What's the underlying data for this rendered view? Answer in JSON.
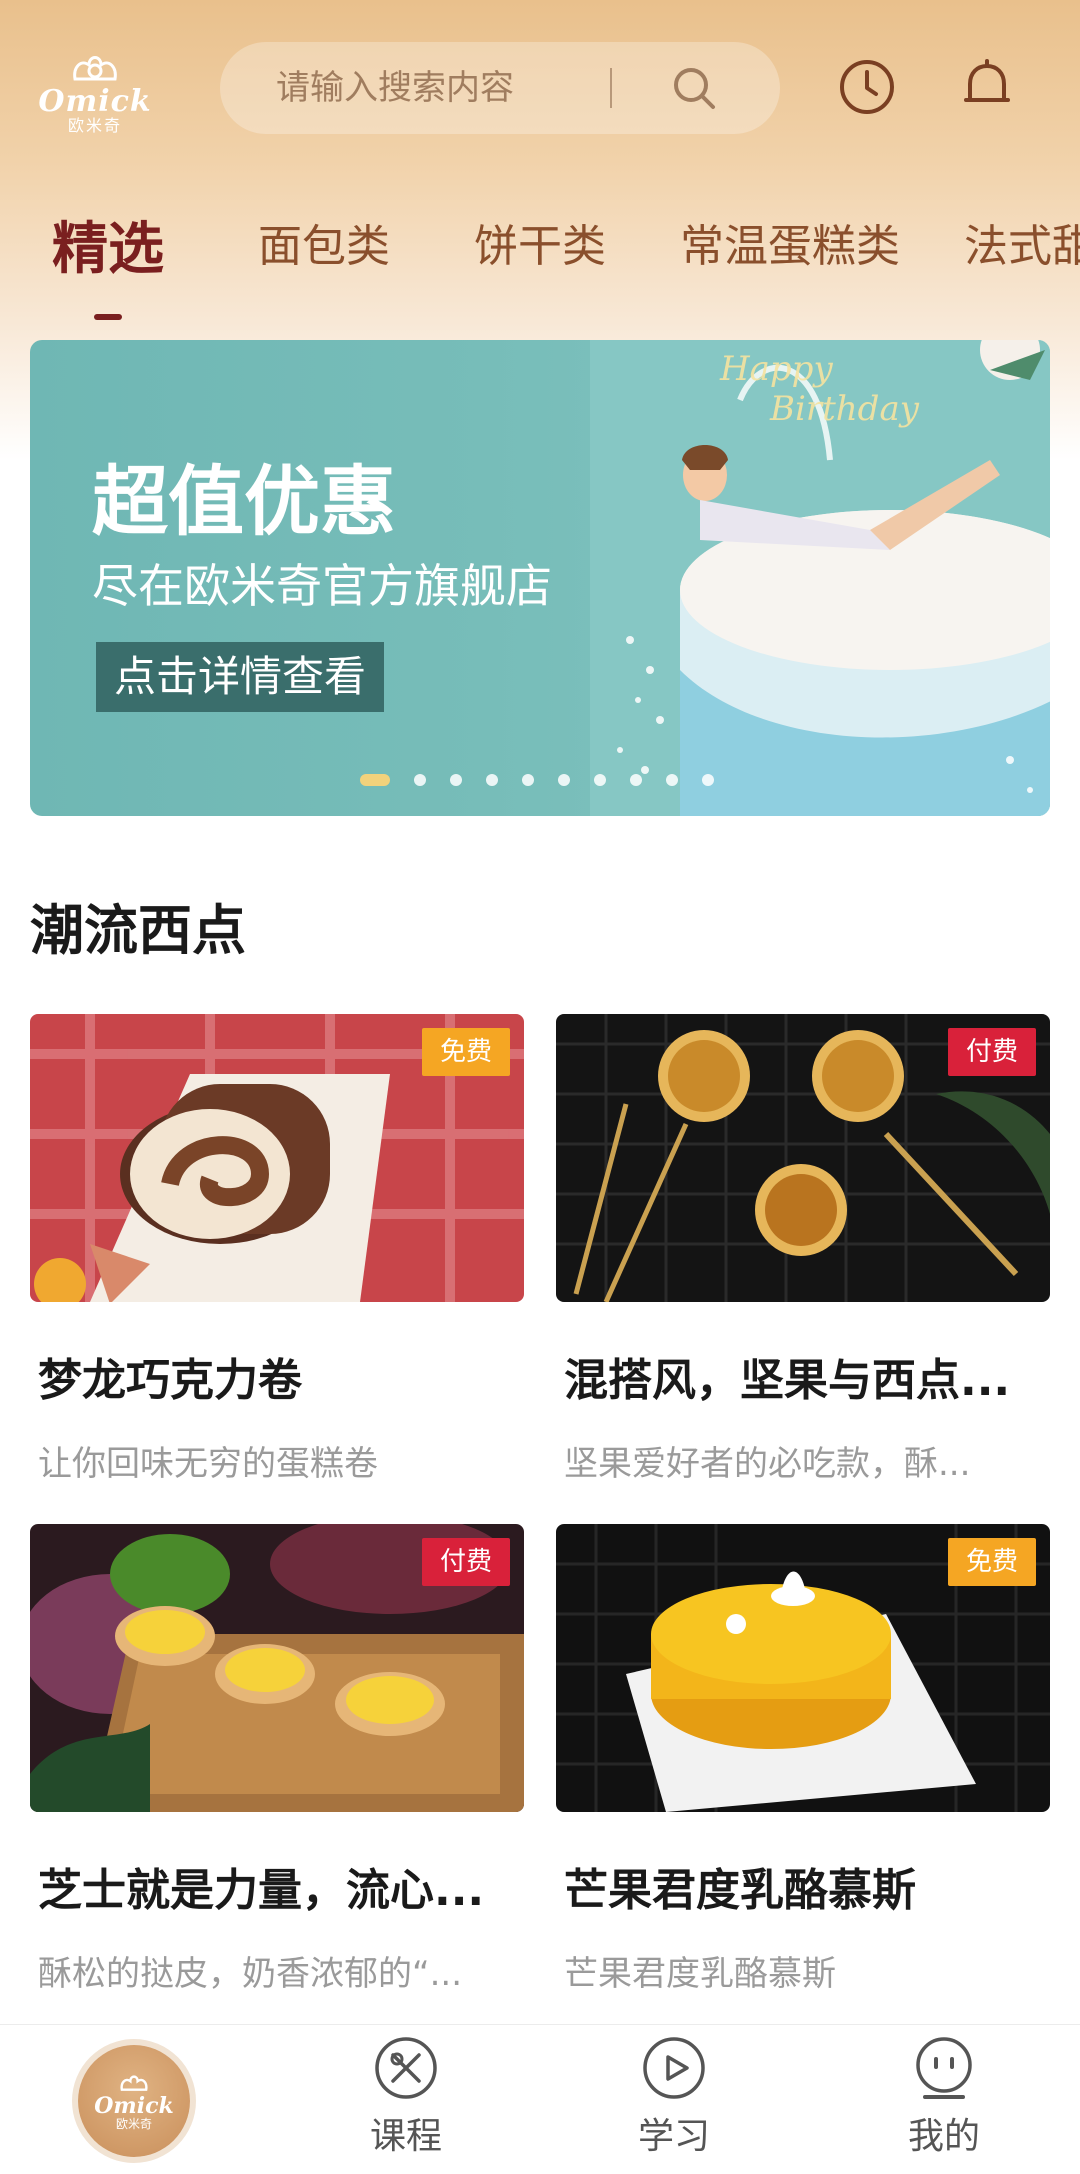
{
  "header": {
    "logo": {
      "brand": "Omick",
      "brand_cn": "欧米奇"
    },
    "search_placeholder": "请输入搜索内容",
    "icons": {
      "search": "search-icon",
      "history": "clock-icon",
      "notifications": "bell-icon"
    }
  },
  "tabs": [
    {
      "label": "精选",
      "active": true
    },
    {
      "label": "面包类",
      "active": false
    },
    {
      "label": "饼干类",
      "active": false
    },
    {
      "label": "常温蛋糕类",
      "active": false
    },
    {
      "label": "法式甜",
      "active": false
    }
  ],
  "banner": {
    "headline": "超值优惠",
    "subline": "尽在欧米奇官方旗舰店",
    "cta": "点击详情查看",
    "dot_count": 10,
    "active_dot": 1
  },
  "section": {
    "title": "潮流西点"
  },
  "cards": [
    {
      "title": "梦龙巧克力卷",
      "desc": "让你回味无穷的蛋糕卷",
      "badge": "免费",
      "badge_type": "free"
    },
    {
      "title": "混搭风，坚果与西点...",
      "desc": "坚果爱好者的必吃款，酥...",
      "badge": "付费",
      "badge_type": "paid"
    },
    {
      "title": "芝士就是力量，流心...",
      "desc": "酥松的挞皮，奶香浓郁的“...",
      "badge": "付费",
      "badge_type": "paid"
    },
    {
      "title": "芒果君度乳酪慕斯",
      "desc": "芒果君度乳酪慕斯",
      "badge": "免费",
      "badge_type": "free"
    }
  ],
  "bottom_nav": {
    "home": {
      "brand": "Omick",
      "brand_cn": "欧米奇"
    },
    "items": [
      {
        "label": "课程",
        "icon": "course-icon"
      },
      {
        "label": "学习",
        "icon": "play-icon"
      },
      {
        "label": "我的",
        "icon": "profile-icon"
      }
    ]
  },
  "colors": {
    "accent": "#7a1f1f",
    "tab_text": "#8a4f2c",
    "free_badge": "#f5a623",
    "paid_badge": "#d9213a",
    "banner_bg": "#77bdb9"
  }
}
